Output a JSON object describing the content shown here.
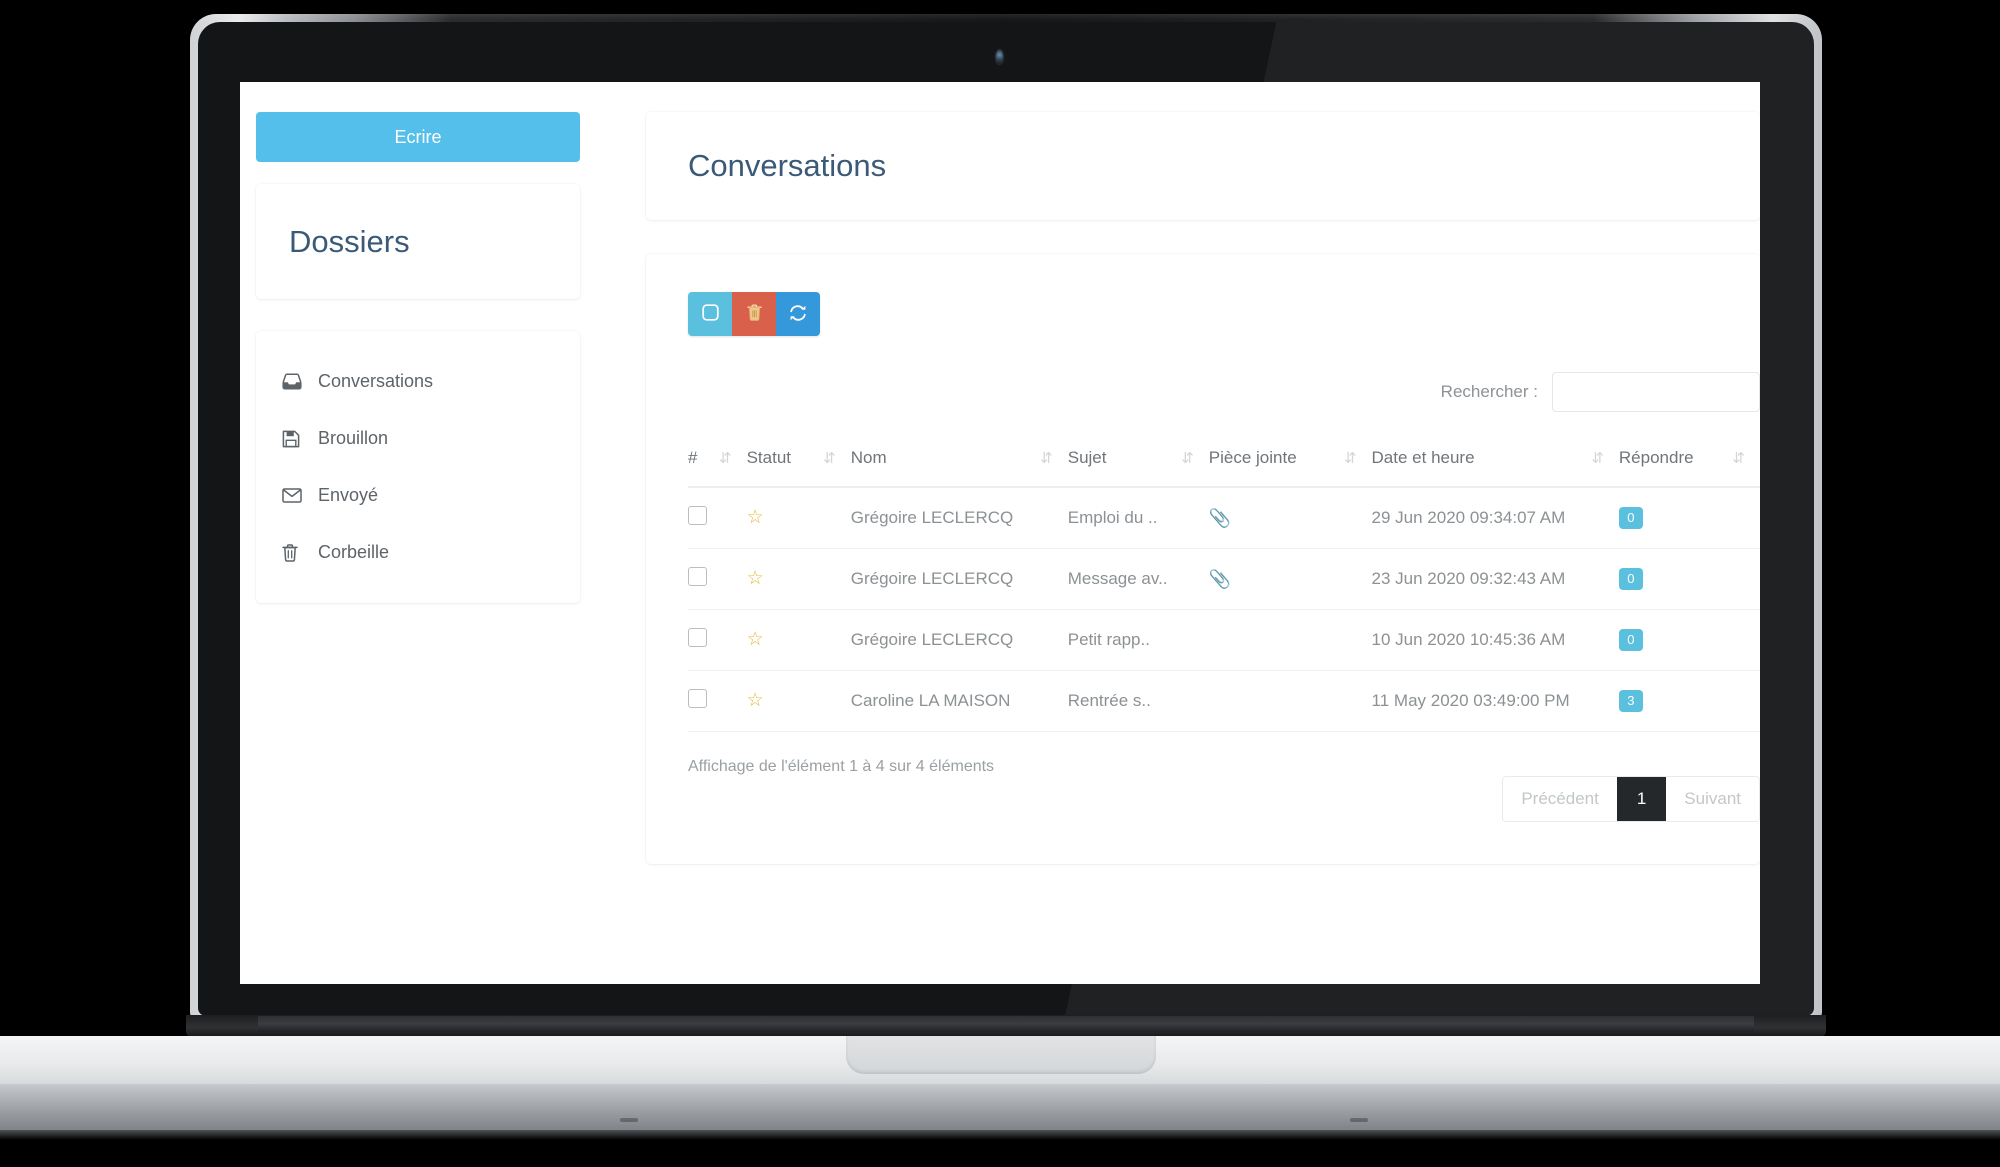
{
  "sidebar": {
    "compose_label": "Ecrire",
    "folders_title": "Dossiers",
    "items": [
      {
        "label": "Conversations",
        "icon": "inbox-icon"
      },
      {
        "label": "Brouillon",
        "icon": "floppy-disk-icon"
      },
      {
        "label": "Envoyé",
        "icon": "envelope-icon"
      },
      {
        "label": "Corbeille",
        "icon": "trash-icon"
      }
    ]
  },
  "page": {
    "title": "Conversations"
  },
  "toolbar": {
    "select_all_icon": "checkbox-icon",
    "delete_icon": "trash-icon",
    "refresh_icon": "refresh-icon"
  },
  "search": {
    "label": "Rechercher :",
    "value": "",
    "placeholder": ""
  },
  "table": {
    "columns": [
      {
        "label": "#",
        "sort_icon": "sort-desc-icon"
      },
      {
        "label": "Statut",
        "sort_icon": "sort-icon"
      },
      {
        "label": "Nom",
        "sort_icon": "sort-icon"
      },
      {
        "label": "Sujet",
        "sort_icon": "sort-icon"
      },
      {
        "label": "Pièce jointe",
        "sort_icon": "sort-icon"
      },
      {
        "label": "Date et heure",
        "sort_icon": "sort-icon"
      },
      {
        "label": "Répondre",
        "sort_icon": "sort-icon"
      }
    ],
    "rows": [
      {
        "checked": false,
        "status_icon": "star-outline-icon",
        "nom": "Grégoire LECLERCQ",
        "sujet": "Emploi du ..",
        "attachment": true,
        "date": "29 Jun 2020 09:34:07 AM",
        "repondre": "0"
      },
      {
        "checked": false,
        "status_icon": "star-outline-icon",
        "nom": "Grégoire LECLERCQ",
        "sujet": "Message av..",
        "attachment": true,
        "date": "23 Jun 2020 09:32:43 AM",
        "repondre": "0"
      },
      {
        "checked": false,
        "status_icon": "star-outline-icon",
        "nom": "Grégoire LECLERCQ",
        "sujet": "Petit rapp..",
        "attachment": false,
        "date": "10 Jun 2020 10:45:36 AM",
        "repondre": "0"
      },
      {
        "checked": false,
        "status_icon": "star-outline-icon",
        "nom": "Caroline LA MAISON",
        "sujet": "Rentrée s..",
        "attachment": false,
        "date": "11 May 2020 03:49:00 PM",
        "repondre": "3"
      }
    ]
  },
  "footer": {
    "info": "Affichage de l'élément 1 à 4 sur 4 éléments",
    "pagination": {
      "previous": "Précédent",
      "current": "1",
      "next": "Suivant"
    }
  },
  "colors": {
    "accent_blue": "#54bfea",
    "badge_blue": "#5bc0de",
    "delete_red": "#d9604a",
    "refresh_blue": "#3498db",
    "title_blue": "#3a5a78",
    "star_gold": "#e8b93a",
    "page_active_bg": "#25282b"
  }
}
